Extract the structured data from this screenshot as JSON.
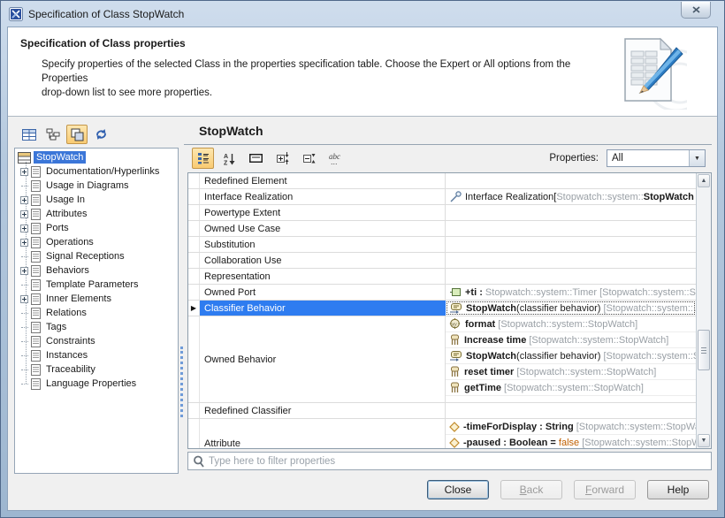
{
  "window": {
    "title": "Specification of Class StopWatch"
  },
  "header": {
    "title": "Specification of Class properties",
    "desc_line1": "Specify properties of the selected Class in the properties specification table. Choose the Expert or All options from the Properties",
    "desc_line2": "drop-down list to see more properties.",
    "art_icon": "document-with-pencil-icon"
  },
  "left": {
    "toolbar": [
      {
        "icon": "table-view-icon",
        "selected": false
      },
      {
        "icon": "tree-structure-icon",
        "selected": false
      },
      {
        "icon": "stacked-panels-icon",
        "selected": true
      },
      {
        "icon": "refresh-icon",
        "selected": false
      }
    ],
    "tree": {
      "items": [
        {
          "label": "StopWatch",
          "selected": true,
          "icon": "class-icon"
        },
        {
          "label": "Documentation/Hyperlinks",
          "expandable": true
        },
        {
          "label": "Usage in Diagrams",
          "expandable": false
        },
        {
          "label": "Usage In",
          "expandable": true
        },
        {
          "label": "Attributes",
          "expandable": true
        },
        {
          "label": "Ports",
          "expandable": true
        },
        {
          "label": "Operations",
          "expandable": true
        },
        {
          "label": "Signal Receptions",
          "expandable": false
        },
        {
          "label": "Behaviors",
          "expandable": true
        },
        {
          "label": "Template Parameters",
          "expandable": false
        },
        {
          "label": "Inner Elements",
          "expandable": true
        },
        {
          "label": "Relations",
          "expandable": false
        },
        {
          "label": "Tags",
          "expandable": false
        },
        {
          "label": "Constraints",
          "expandable": false
        },
        {
          "label": "Instances",
          "expandable": false
        },
        {
          "label": "Traceability",
          "expandable": false
        },
        {
          "label": "Language Properties",
          "expandable": false
        }
      ]
    }
  },
  "right": {
    "heading": "StopWatch",
    "toolbar": [
      {
        "icon": "categorized-view-icon",
        "selected": true
      },
      {
        "icon": "sort-alphabetically-icon",
        "selected": false
      },
      {
        "icon": "show-description-icon",
        "selected": false
      },
      {
        "icon": "expand-nodes-icon",
        "selected": false
      },
      {
        "icon": "collapse-nodes-icon",
        "selected": false
      },
      {
        "icon": "show-full-names-icon",
        "selected": false
      }
    ],
    "properties_label": "Properties:",
    "properties_value": "All"
  },
  "table": {
    "rows": [
      {
        "label": "Redefined Element"
      },
      {
        "label": "Interface Realization",
        "icon": "interface-realization-icon",
        "value_parts": [
          {
            "text": "Interface Realization[",
            "style": "dark"
          },
          {
            "text": "Stopwatch::system::",
            "style": "gray"
          },
          {
            "text": "StopWatch ->",
            "style": "dark-bold"
          }
        ]
      },
      {
        "label": "Powertype Extent"
      },
      {
        "label": "Owned Use Case"
      },
      {
        "label": "Substitution"
      },
      {
        "label": "Collaboration Use"
      },
      {
        "label": "Representation"
      },
      {
        "label": "Owned Port",
        "icon": "port-icon",
        "value_parts": [
          {
            "text": "+ti : ",
            "style": "dark-bold"
          },
          {
            "text": "Stopwatch::system::Timer ",
            "style": "gray"
          },
          {
            "text": "[Stopwatch::system::St",
            "style": "gray"
          }
        ]
      },
      {
        "label": "Classifier Behavior",
        "selected": true,
        "icon": "state-machine-icon",
        "value_parts": [
          {
            "text": "StopWatch",
            "style": "dark-bold"
          },
          {
            "text": "(classifier behavior) ",
            "style": "dark"
          },
          {
            "text": "[Stopwatch::system::…",
            "style": "gray"
          }
        ]
      },
      {
        "label": "Owned Behavior",
        "values": [
          {
            "icon": "opaque-behavior-icon",
            "parts": [
              {
                "text": "format ",
                "style": "dark-bold"
              },
              {
                "text": "[Stopwatch::system::StopWatch]",
                "style": "gray"
              }
            ]
          },
          {
            "icon": "activity-icon",
            "parts": [
              {
                "text": "Increase time ",
                "style": "dark-bold"
              },
              {
                "text": "[Stopwatch::system::StopWatch]",
                "style": "gray"
              }
            ]
          },
          {
            "icon": "state-machine-icon",
            "parts": [
              {
                "text": "StopWatch",
                "style": "dark-bold"
              },
              {
                "text": "(classifier behavior) ",
                "style": "dark"
              },
              {
                "text": "[Stopwatch::system::Sto",
                "style": "gray"
              }
            ]
          },
          {
            "icon": "activity-icon",
            "parts": [
              {
                "text": "reset timer ",
                "style": "dark-bold"
              },
              {
                "text": "[Stopwatch::system::StopWatch]",
                "style": "gray"
              }
            ]
          },
          {
            "icon": "activity-icon",
            "parts": [
              {
                "text": "getTime ",
                "style": "dark-bold"
              },
              {
                "text": "[Stopwatch::system::StopWatch]",
                "style": "gray"
              }
            ]
          }
        ]
      },
      {
        "label": "Redefined Classifier"
      },
      {
        "label": "Attribute",
        "clipped": true,
        "values": [
          {
            "icon": "attribute-icon",
            "parts": [
              {
                "text": "-timeForDisplay : String ",
                "style": "dark-bold"
              },
              {
                "text": "[Stopwatch::system::StopWatc",
                "style": "gray"
              }
            ]
          },
          {
            "icon": "attribute-icon",
            "parts": [
              {
                "text": "-paused : Boolean = ",
                "style": "dark-bold"
              },
              {
                "text": "false ",
                "style": "orange"
              },
              {
                "text": "[Stopwatch::system::StopWa",
                "style": "gray"
              }
            ]
          }
        ]
      }
    ]
  },
  "filter": {
    "placeholder": "Type here to filter properties",
    "icon": "search-icon"
  },
  "buttons": [
    {
      "label": "Close",
      "state": "default"
    },
    {
      "label": "Back",
      "state": "disabled"
    },
    {
      "label": "Forward",
      "state": "disabled"
    },
    {
      "label": "Help",
      "state": "enabled"
    }
  ],
  "colors": {
    "selection_blue": "#2e7cf0",
    "tree_selection_blue": "#3b76d8",
    "toolbar_selection_orange": "#f9cb72",
    "muted_text": "#9aa0a6",
    "default_value_orange": "#c05f00",
    "frame_blue": "#9db6d0"
  }
}
